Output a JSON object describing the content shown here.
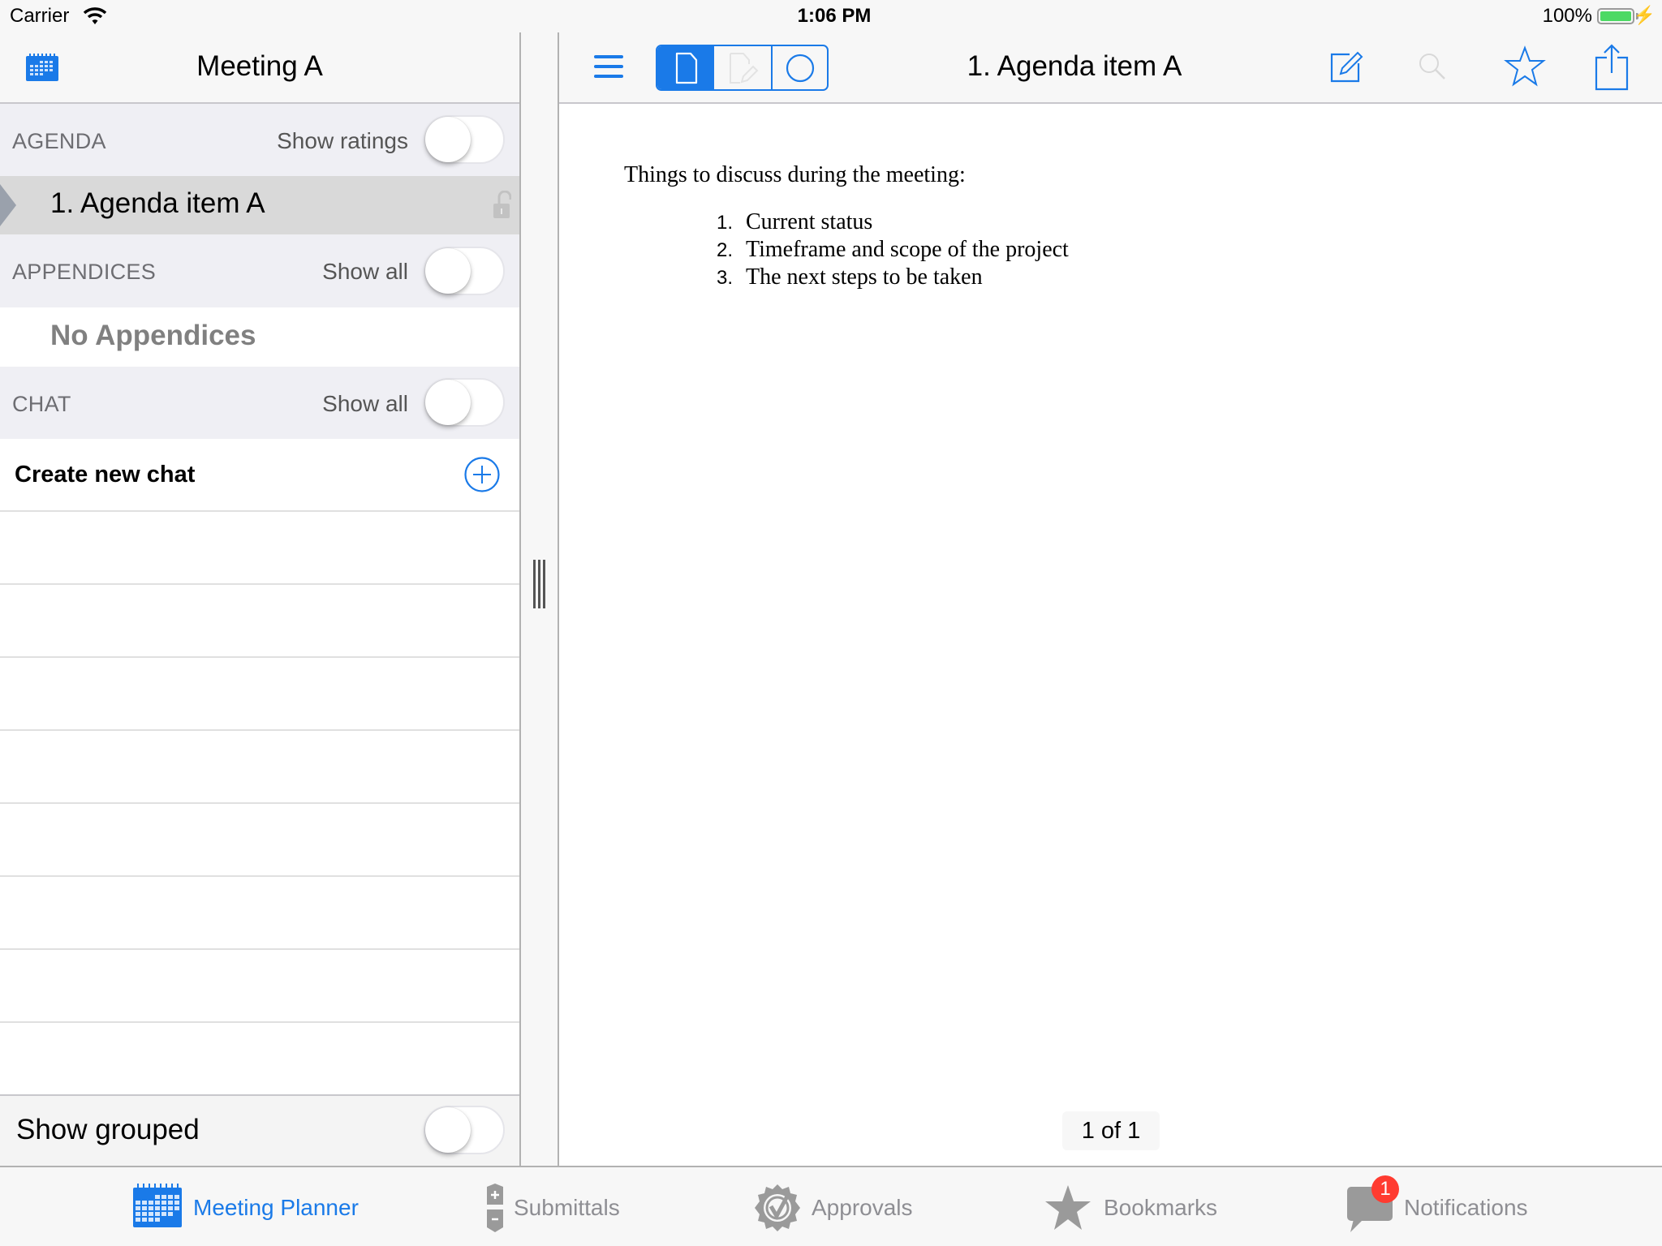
{
  "status_bar": {
    "carrier": "Carrier",
    "time": "1:06 PM",
    "battery_percent": "100%",
    "battery_level": 1.0,
    "charging": true
  },
  "left_panel": {
    "title": "Meeting A",
    "calendar_icon": "calendar-icon",
    "sections": {
      "agenda": {
        "label": "AGENDA",
        "toggle_label": "Show ratings",
        "toggle_on": false,
        "items": [
          {
            "label": "1. Agenda item A",
            "selected": true,
            "lock_icon": "unlock-icon"
          }
        ]
      },
      "appendices": {
        "label": "APPENDICES",
        "toggle_label": "Show all",
        "toggle_on": false,
        "empty_text": "No Appendices"
      },
      "chat": {
        "label": "CHAT",
        "toggle_label": "Show all",
        "toggle_on": false,
        "create_label": "Create new chat"
      }
    },
    "show_grouped": {
      "label": "Show grouped",
      "toggle_on": false
    }
  },
  "document": {
    "title": "1. Agenda item A",
    "view_modes": [
      {
        "name": "document",
        "selected": true
      },
      {
        "name": "annotate",
        "selected": false,
        "disabled": true
      },
      {
        "name": "circle",
        "selected": false
      }
    ],
    "toolbar_icons": [
      "edit-icon",
      "search-icon",
      "star-icon",
      "share-icon"
    ],
    "content": {
      "intro": "Things to discuss during the meeting:",
      "items": [
        {
          "num": "1.",
          "text": "Current status"
        },
        {
          "num": "2.",
          "text": "Timeframe and scope of the project"
        },
        {
          "num": "3.",
          "text": "The next steps to be taken"
        }
      ]
    },
    "page_indicator": "1 of 1"
  },
  "tab_bar": {
    "tabs": [
      {
        "label": "Meeting Planner",
        "icon": "calendar-icon",
        "active": true
      },
      {
        "label": "Submittals",
        "icon": "submittals-icon",
        "active": false
      },
      {
        "label": "Approvals",
        "icon": "approval-badge-icon",
        "active": false
      },
      {
        "label": "Bookmarks",
        "icon": "star-icon",
        "active": false
      },
      {
        "label": "Notifications",
        "icon": "chat-bubble-icon",
        "active": false,
        "badge": "1"
      }
    ]
  },
  "colors": {
    "accent": "#1a7ae8",
    "inactive": "#8e8e93",
    "badge": "#ff3b30",
    "battery": "#4cd964",
    "section_bg": "#efeff4",
    "selected_row_bg": "#d9d9d9"
  }
}
